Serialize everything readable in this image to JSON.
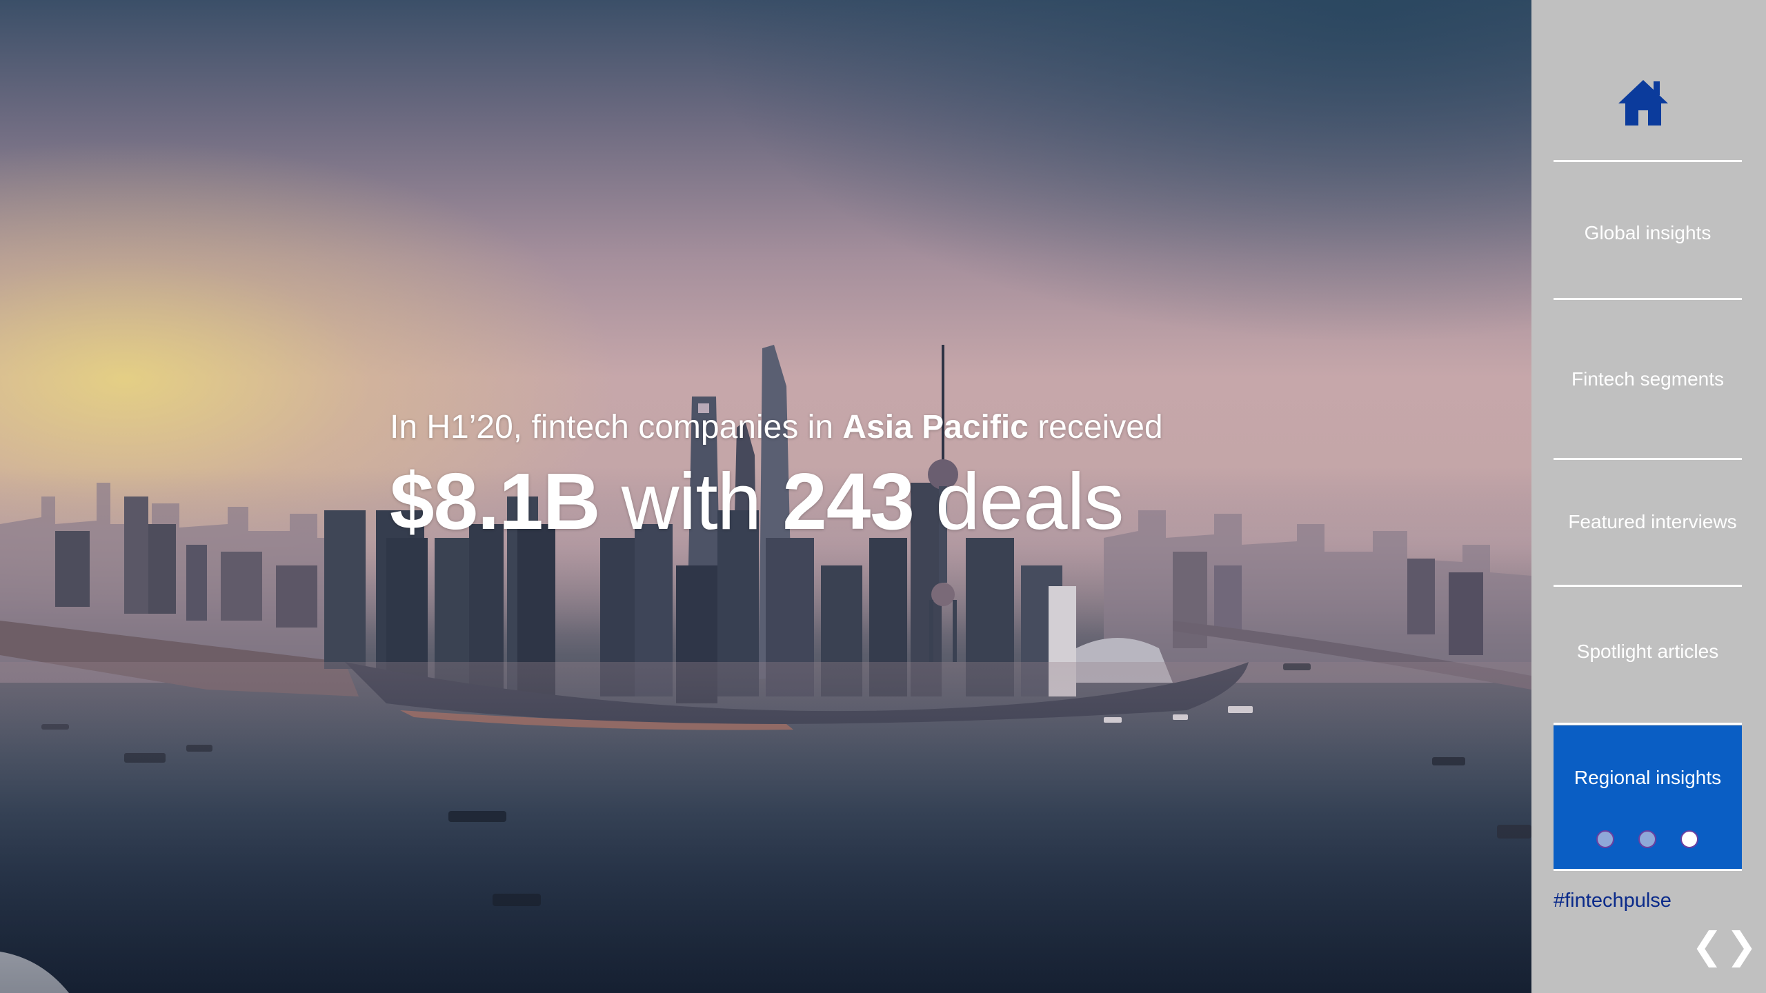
{
  "headline": {
    "intro_prefix": "In H1’20, fintech companies in ",
    "intro_region": "Asia Pacific",
    "intro_suffix": " received",
    "amount": "$8.1B",
    "connector": " with ",
    "deal_count": "243",
    "deals_word": " deals"
  },
  "sidebar": {
    "home_icon": "home-icon",
    "items": [
      {
        "label": "Global insights"
      },
      {
        "label": "Fintech segments"
      },
      {
        "label": "Featured interviews"
      },
      {
        "label": "Spotlight articles"
      }
    ],
    "active_item": {
      "label": "Regional insights",
      "page_dots_total": 3,
      "page_dots_active": 3
    },
    "hashtag": "#fintechpulse",
    "prev_arrow": "❮",
    "next_arrow": "❯"
  },
  "colors": {
    "sidebar_bg": "#c0c0c0",
    "active_bg": "#0a5ec4",
    "brand_navy": "#0a2a8a",
    "home_icon": "#0b3b9c",
    "dot_inactive": "#8fa9d8",
    "dot_active": "#ffffff"
  }
}
